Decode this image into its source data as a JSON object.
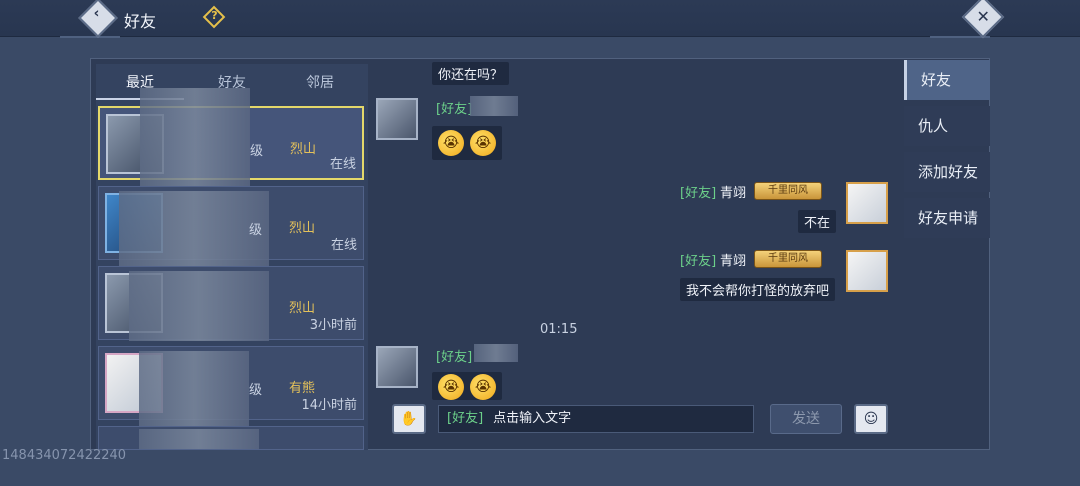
{
  "header": {
    "title": "好友",
    "back_icon": "‹",
    "help_icon": "?",
    "close_icon": "✕"
  },
  "tabs": [
    "最近",
    "好友",
    "邻居"
  ],
  "friends": [
    {
      "level": "级",
      "faction": "烈山",
      "status": "在线"
    },
    {
      "level": "级",
      "faction": "烈山",
      "status": "在线"
    },
    {
      "level": "",
      "faction": "烈山",
      "status": "3小时前"
    },
    {
      "level": "级",
      "faction": "有熊",
      "status": "14小时前"
    }
  ],
  "chat": {
    "top_partial_text": "你还在吗？",
    "messages": [
      {
        "channel": "[好友]",
        "emoji": [
          "😭",
          "😭"
        ]
      },
      {
        "channel": "[好友]",
        "sender": "青翊",
        "badge": "千里同风",
        "text": "不在"
      },
      {
        "channel": "[好友]",
        "sender": "青翊",
        "badge": "千里同风",
        "text": "我不会帮你打怪的放弃吧"
      },
      {
        "channel": "[好友]",
        "emoji": [
          "😭",
          "😭"
        ]
      }
    ],
    "timestamp": "01:15"
  },
  "input": {
    "channel": "[好友]",
    "placeholder": "点击输入文字",
    "send_label": "发送",
    "voice_icon": "✋",
    "emoji_icon": "☺"
  },
  "right_nav": [
    "好友",
    "仇人",
    "添加好友",
    "好友申请"
  ],
  "footer_id": "148434072422240"
}
